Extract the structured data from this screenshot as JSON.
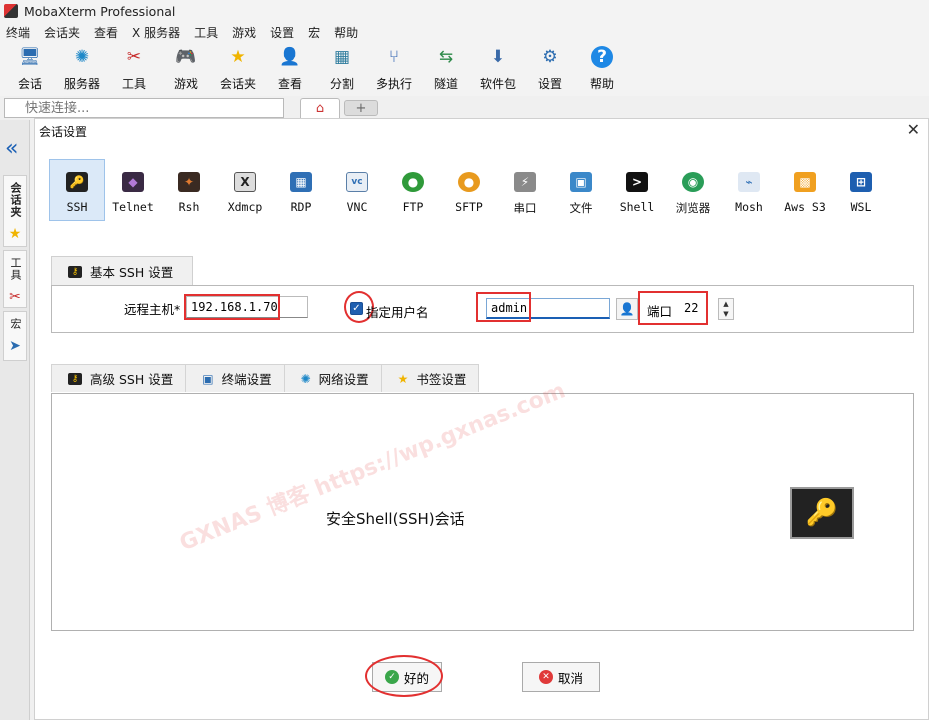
{
  "app": {
    "title": "MobaXterm Professional"
  },
  "menu": [
    "终端",
    "会话夹",
    "查看",
    "X 服务器",
    "工具",
    "游戏",
    "设置",
    "宏",
    "帮助"
  ],
  "toolbar": [
    {
      "label": "会话",
      "icon": "session-icon"
    },
    {
      "label": "服务器",
      "icon": "servers-icon"
    },
    {
      "label": "工具",
      "icon": "tools-icon"
    },
    {
      "label": "游戏",
      "icon": "games-icon"
    },
    {
      "label": "会话夹",
      "icon": "star-icon"
    },
    {
      "label": "查看",
      "icon": "view-icon"
    },
    {
      "label": "分割",
      "icon": "split-icon"
    },
    {
      "label": "多执行",
      "icon": "multiexec-icon"
    },
    {
      "label": "隧道",
      "icon": "tunnel-icon"
    },
    {
      "label": "软件包",
      "icon": "package-icon"
    },
    {
      "label": "设置",
      "icon": "settings-icon"
    },
    {
      "label": "帮助",
      "icon": "help-icon"
    }
  ],
  "quick": {
    "placeholder": "快速连接..."
  },
  "sidebar": {
    "tab_sessions": "会话夹",
    "tab_tools": "工具",
    "tab_macros": "宏"
  },
  "dialog": {
    "title": "会话设置",
    "close": "✕",
    "protocols": [
      {
        "label": "SSH",
        "color": "#222222",
        "glyph": "🔑",
        "selected": true
      },
      {
        "label": "Telnet",
        "color": "#3a2a44",
        "glyph": "◆",
        "selected": false
      },
      {
        "label": "Rsh",
        "color": "#3a2a22",
        "glyph": "✦",
        "selected": false
      },
      {
        "label": "Xdmcp",
        "color": "#444444",
        "glyph": "X",
        "selected": false
      },
      {
        "label": "RDP",
        "color": "#2f6fb5",
        "glyph": "▦",
        "selected": false
      },
      {
        "label": "VNC",
        "color": "#5a7fa8",
        "glyph": "vc",
        "selected": false
      },
      {
        "label": "FTP",
        "color": "#2f9a3a",
        "glyph": "●",
        "selected": false
      },
      {
        "label": "SFTP",
        "color": "#e89a1e",
        "glyph": "●",
        "selected": false
      },
      {
        "label": "串口",
        "color": "#8a8a8a",
        "glyph": "⚡",
        "selected": false
      },
      {
        "label": "文件",
        "color": "#3b88c9",
        "glyph": "▣",
        "selected": false
      },
      {
        "label": "Shell",
        "color": "#111111",
        "glyph": ">",
        "selected": false
      },
      {
        "label": "浏览器",
        "color": "#2a9d58",
        "glyph": "◉",
        "selected": false
      },
      {
        "label": "Mosh",
        "color": "#2f6fb5",
        "glyph": "⌁",
        "selected": false
      },
      {
        "label": "Aws S3",
        "color": "#f0a020",
        "glyph": "▩",
        "selected": false
      },
      {
        "label": "WSL",
        "color": "#1e5fb0",
        "glyph": "⊞",
        "selected": false
      }
    ],
    "basic_tab": "基本 SSH 设置",
    "remote_host_label": "远程主机*",
    "remote_host": "192.168.1.70",
    "specify_user_label": "指定用户名",
    "username": "admin",
    "port_label": "端口",
    "port": "22",
    "adv_tabs": [
      "高级 SSH 设置",
      "终端设置",
      "网络设置",
      "书签设置"
    ],
    "description": "安全Shell(SSH)会话",
    "ok": "好的",
    "cancel": "取消"
  },
  "watermark": "GXNAS 博客  https://wp.gxnas.com"
}
